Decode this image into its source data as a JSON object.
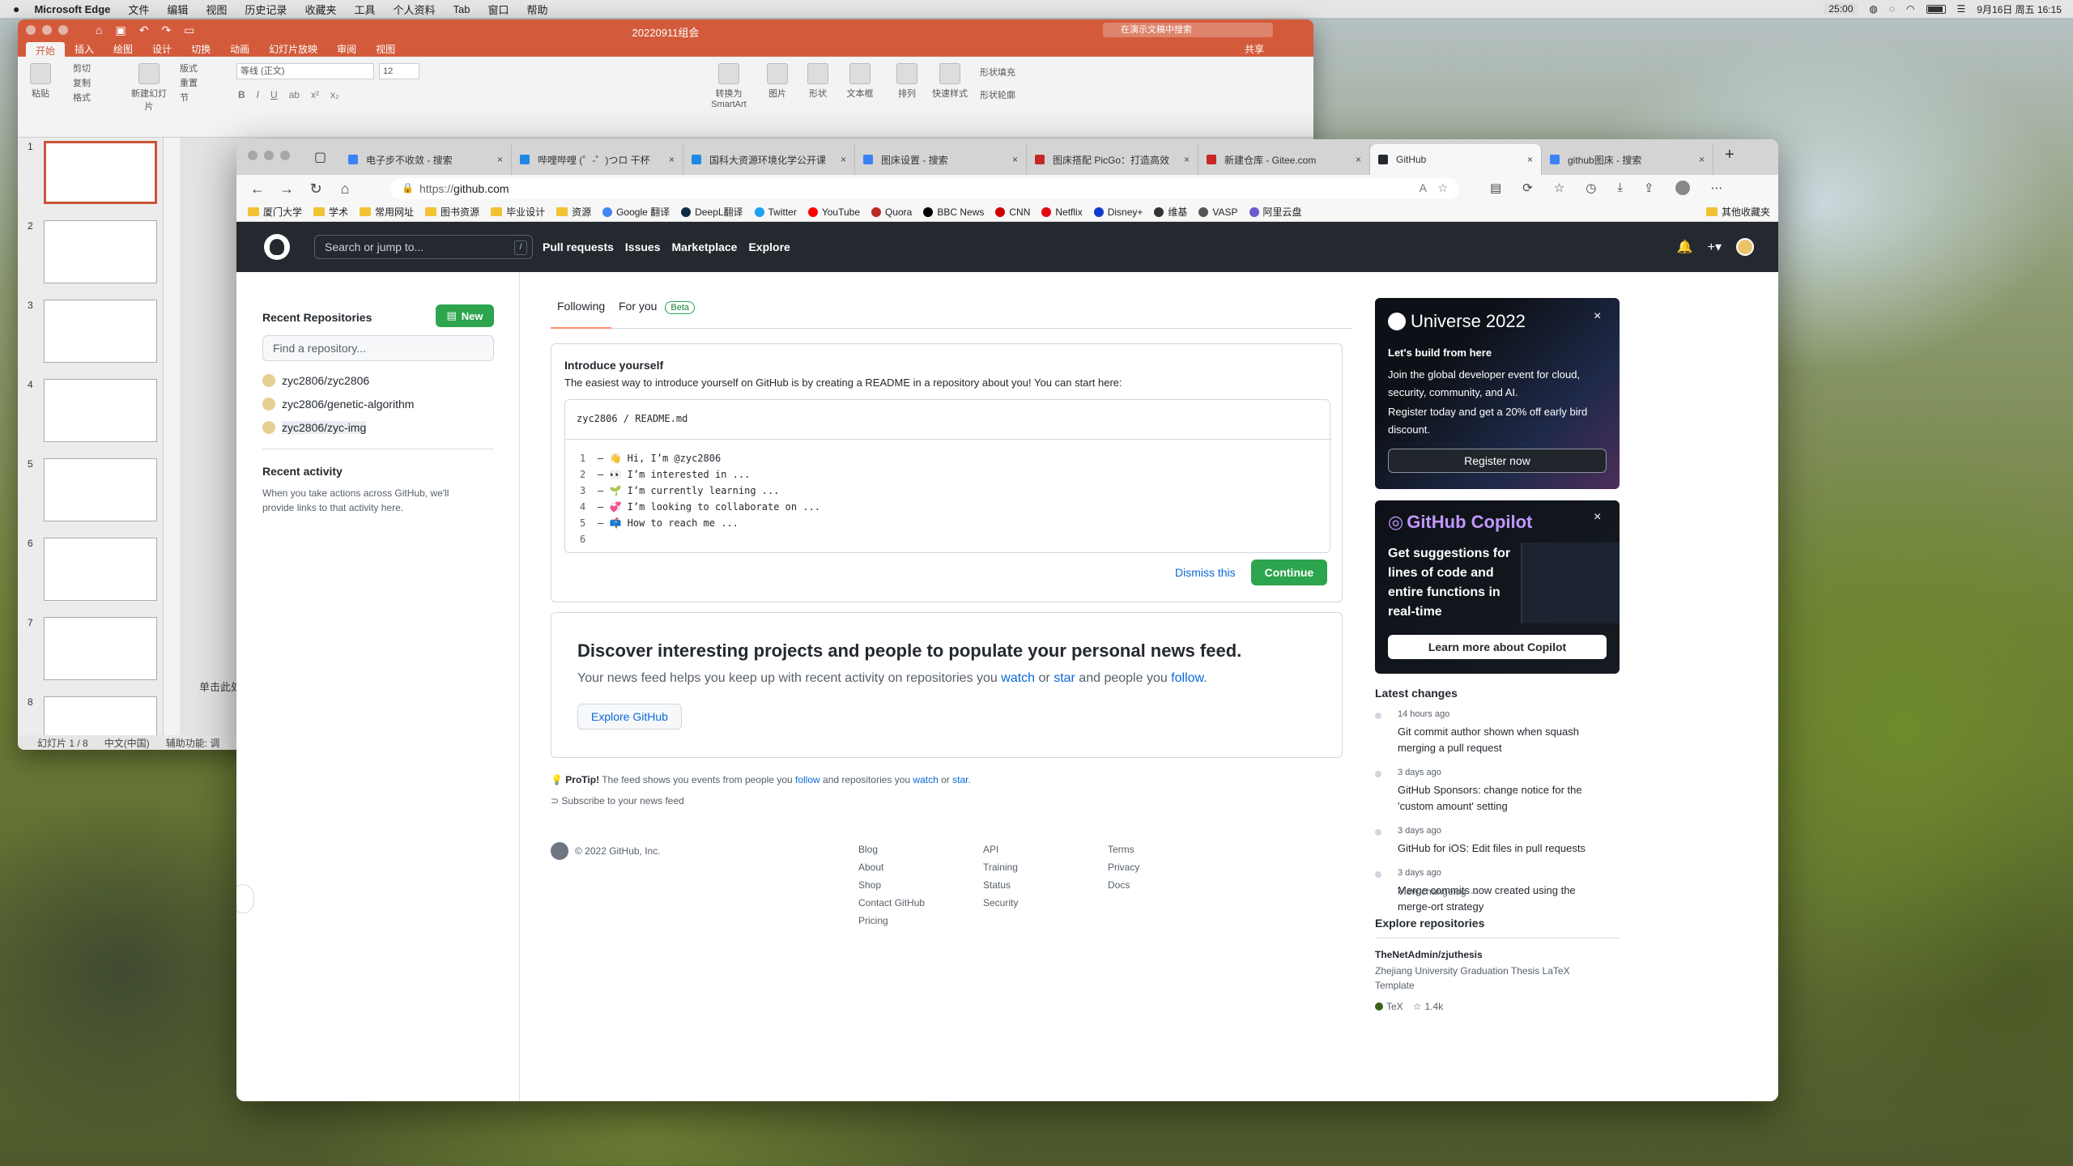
{
  "menubar": {
    "app": "Microsoft Edge",
    "items": [
      "文件",
      "编辑",
      "视图",
      "历史记录",
      "收藏夹",
      "工具",
      "个人资料",
      "Tab",
      "窗口",
      "帮助"
    ],
    "clock": "25:00",
    "date": "9月16日 周五 16:15"
  },
  "ppt": {
    "title": "20220911组会",
    "tabs": [
      "开始",
      "插入",
      "绘图",
      "设计",
      "切换",
      "动画",
      "幻灯片放映",
      "审阅",
      "视图"
    ],
    "share": "共享",
    "search_placeholder": "在演示文稿中搜索",
    "ribbon": {
      "paste": "粘贴",
      "cut": "剪切",
      "copy": "复制",
      "format": "格式",
      "new_slide": "新建幻灯片",
      "layout": "版式",
      "reset": "重置",
      "section": "节",
      "font": "等线 (正文)",
      "size": "12",
      "smartart": "转换为SmartArt",
      "picture": "图片",
      "shape": "形状",
      "textbox": "文本框",
      "arrange": "排列",
      "quick_style": "快速样式",
      "shape_fill": "形状填充",
      "shape_outline": "形状轮廓"
    },
    "slide_numbers": [
      "1",
      "2",
      "3",
      "4",
      "5",
      "6",
      "7",
      "8"
    ],
    "click_hint": "单击此处添",
    "status": [
      "幻灯片 1 / 8",
      "中文(中国)",
      "辅助功能: 调"
    ]
  },
  "edge": {
    "tabs": [
      {
        "label": "电子步不收敛 - 搜索",
        "color": "#3b82f6"
      },
      {
        "label": "哔哩哔哩 (゜-゜)つロ 干杯",
        "color": "#1e88e5"
      },
      {
        "label": "国科大资源环境化学公开课",
        "color": "#1e88e5"
      },
      {
        "label": "图床设置 - 搜索",
        "color": "#3b82f6"
      },
      {
        "label": "图床搭配 PicGo：打造高效",
        "color": "#c62828"
      },
      {
        "label": "新建仓库 - Gitee.com",
        "color": "#c62828"
      },
      {
        "label": "GitHub",
        "color": "#24292f"
      },
      {
        "label": "github图床 - 搜索",
        "color": "#3b82f6"
      }
    ],
    "url_prefix": "https://",
    "url_host": "github.com",
    "bookmarks": [
      {
        "label": "厦门大学",
        "type": "folder"
      },
      {
        "label": "学术",
        "type": "folder"
      },
      {
        "label": "常用网址",
        "type": "folder"
      },
      {
        "label": "图书资源",
        "type": "folder"
      },
      {
        "label": "毕业设计",
        "type": "folder"
      },
      {
        "label": "资源",
        "type": "folder"
      },
      {
        "label": "Google 翻译",
        "type": "site",
        "color": "#4285f4"
      },
      {
        "label": "DeepL翻译",
        "type": "site",
        "color": "#0f2b46"
      },
      {
        "label": "Twitter",
        "type": "site",
        "color": "#1da1f2"
      },
      {
        "label": "YouTube",
        "type": "site",
        "color": "#ff0000"
      },
      {
        "label": "Quora",
        "type": "site",
        "color": "#b92b27"
      },
      {
        "label": "BBC News",
        "type": "site",
        "color": "#000000"
      },
      {
        "label": "CNN",
        "type": "site",
        "color": "#cc0000"
      },
      {
        "label": "Netflix",
        "type": "site",
        "color": "#e50914"
      },
      {
        "label": "Disney+",
        "type": "site",
        "color": "#113ccf"
      },
      {
        "label": "维基",
        "type": "site",
        "color": "#333333"
      },
      {
        "label": "VASP",
        "type": "site",
        "color": "#555555"
      },
      {
        "label": "阿里云盘",
        "type": "site",
        "color": "#6a5acd"
      }
    ],
    "other_favorites": "其他收藏夹"
  },
  "github": {
    "search_placeholder": "Search or jump to...",
    "search_key": "/",
    "nav": [
      "Pull requests",
      "Issues",
      "Marketplace",
      "Explore"
    ],
    "recent_repos_title": "Recent Repositories",
    "new_button": "New",
    "find_repo_placeholder": "Find a repository...",
    "repos": [
      "zyc2806/zyc2806",
      "zyc2806/genetic-algorithm",
      "zyc2806/zyc-img"
    ],
    "recent_activity_title": "Recent activity",
    "recent_activity_text": "When you take actions across GitHub, we'll provide links to that activity here.",
    "feed_tabs": {
      "following": "Following",
      "for_you": "For you",
      "beta": "Beta"
    },
    "intro": {
      "title": "Introduce yourself",
      "text": "The easiest way to introduce yourself on GitHub is by creating a README in a repository about you! You can start here:",
      "path_user": "zyc2806",
      "path_sep": " / ",
      "path_file": "README.md",
      "lines": [
        {
          "n": "1",
          "t": "– 👋 Hi, I’m @zyc2806"
        },
        {
          "n": "2",
          "t": "– 👀 I’m interested in ..."
        },
        {
          "n": "3",
          "t": "– 🌱 I’m currently learning ..."
        },
        {
          "n": "4",
          "t": "– 💞️ I’m looking to collaborate on ..."
        },
        {
          "n": "5",
          "t": "– 📫 How to reach me ..."
        },
        {
          "n": "6",
          "t": ""
        }
      ],
      "dismiss": "Dismiss this",
      "continue": "Continue"
    },
    "discover": {
      "title": "Discover interesting projects and people to populate your personal news feed.",
      "text_a": "Your news feed helps you keep up with recent activity on repositories you ",
      "watch": "watch",
      "or": " or ",
      "star": "star",
      "text_b": " and people you ",
      "follow": "follow",
      "period": ".",
      "button": "Explore GitHub"
    },
    "protip": {
      "label": "ProTip!",
      "text_a": " The feed shows you events from people you ",
      "follow": "follow",
      "text_b": " and repositories you ",
      "watch": "watch",
      "or": " or ",
      "star": "star",
      "period": "."
    },
    "subscribe": "Subscribe to your news feed",
    "footer": {
      "copyright": "© 2022 GitHub, Inc.",
      "col1": [
        "Blog",
        "About",
        "Shop",
        "Contact GitHub",
        "Pricing"
      ],
      "col2": [
        "API",
        "Training",
        "Status",
        "Security"
      ],
      "col3": [
        "Terms",
        "Privacy",
        "Docs"
      ]
    },
    "universe": {
      "title": "Universe 2022",
      "heading": "Let's build from here",
      "p1": "Join the global developer event for cloud, security, community, and AI.",
      "p2": "Register today and get a 20% off early bird discount.",
      "button": "Register now"
    },
    "copilot": {
      "title": "GitHub Copilot",
      "text": "Get suggestions for lines of code and entire functions in real-time",
      "button": "Learn more about Copilot"
    },
    "latest_changes_title": "Latest changes",
    "changes": [
      {
        "time": "14 hours ago",
        "text": "Git commit author shown when squash merging a pull request"
      },
      {
        "time": "3 days ago",
        "text": "GitHub Sponsors: change notice for the 'custom amount' setting"
      },
      {
        "time": "3 days ago",
        "text": "GitHub for iOS: Edit files in pull requests"
      },
      {
        "time": "3 days ago",
        "text": "Merge commits now created using the merge-ort strategy"
      }
    ],
    "view_changelog": "View changelog →",
    "explore_repos_title": "Explore repositories",
    "explore_repo": {
      "name": "TheNetAdmin/zjuthesis",
      "desc": "Zhejiang University Graduation Thesis LaTeX Template",
      "lang": "TeX",
      "lang_color": "#3d6117",
      "stars": "1.4k"
    }
  }
}
